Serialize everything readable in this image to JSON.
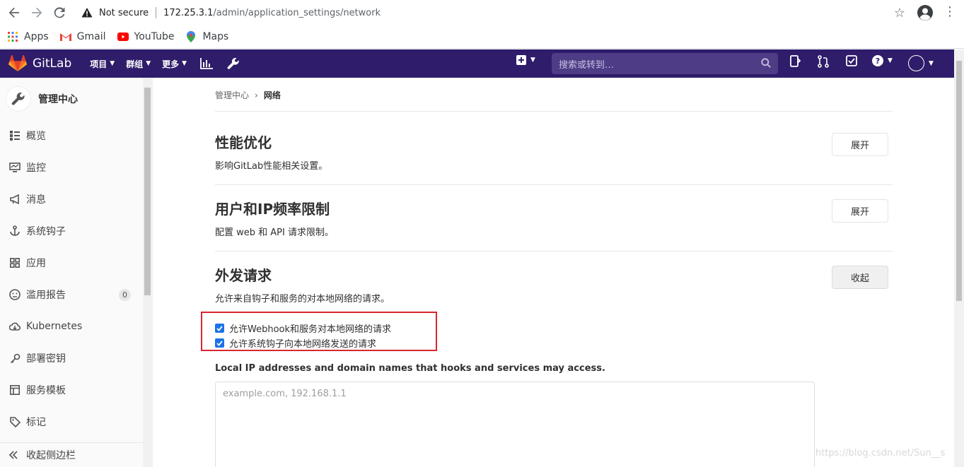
{
  "browser": {
    "not_secure": "Not secure",
    "url_host": "172.25.3.1",
    "url_path": "/admin/application_settings/network",
    "bookmarks": [
      {
        "label": "Apps",
        "icon": "apps-grid-icon"
      },
      {
        "label": "Gmail",
        "icon": "gmail-icon"
      },
      {
        "label": "YouTube",
        "icon": "youtube-icon"
      },
      {
        "label": "Maps",
        "icon": "maps-icon"
      }
    ]
  },
  "header": {
    "brand": "GitLab",
    "menu": [
      "项目",
      "群组",
      "更多"
    ],
    "search_placeholder": "搜索或转到…",
    "color": "#2f1c6a"
  },
  "sidebar": {
    "title": "管理中心",
    "items": [
      {
        "label": "概览",
        "icon": "overview-icon"
      },
      {
        "label": "监控",
        "icon": "monitor-icon"
      },
      {
        "label": "消息",
        "icon": "messages-icon"
      },
      {
        "label": "系统钩子",
        "icon": "hook-icon"
      },
      {
        "label": "应用",
        "icon": "apps-icon"
      },
      {
        "label": "滥用报告",
        "icon": "abuse-icon",
        "badge": "0"
      },
      {
        "label": "Kubernetes",
        "icon": "kubernetes-icon"
      },
      {
        "label": "部署密钥",
        "icon": "key-icon"
      },
      {
        "label": "服务模板",
        "icon": "template-icon"
      },
      {
        "label": "标记",
        "icon": "label-icon"
      }
    ],
    "collapse": "收起侧边栏"
  },
  "main": {
    "breadcrumb": [
      "管理中心",
      "网络"
    ],
    "sections": [
      {
        "title": "性能优化",
        "desc": "影响GitLab性能相关设置。",
        "button": "展开"
      },
      {
        "title": "用户和IP频率限制",
        "desc": "配置 web 和 API 请求限制。",
        "button": "展开"
      },
      {
        "title": "外发请求",
        "desc": "允许来自钩子和服务的对本地网络的请求。",
        "button": "收起"
      }
    ],
    "checkboxes": [
      {
        "label": "允许Webhook和服务对本地网络的请求",
        "checked": true
      },
      {
        "label": "允许系统钩子向本地网络发送的请求",
        "checked": true
      }
    ],
    "field_label": "Local IP addresses and domain names that hooks and services may access.",
    "field_placeholder": "example.com, 192.168.1.1"
  },
  "watermark": "https://blog.csdn.net/Sun__s"
}
